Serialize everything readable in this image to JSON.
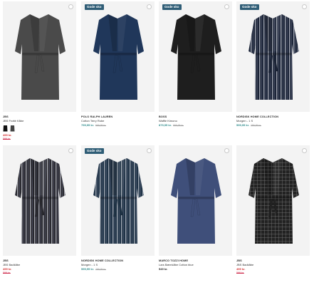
{
  "products": [
    {
      "badge": "",
      "brand": "JBS",
      "name": "JBS Frotté Kåbe",
      "price": "499 kr.",
      "was": "",
      "old_price": "599 kr.",
      "price_tone": "red",
      "robe_color": "#4a4a4a",
      "pattern": "plain",
      "has_swatches": true
    },
    {
      "badge": "Gode sko",
      "brand": "POLO RALPH LAUREN",
      "name": "Cotton Terry Robe",
      "price": "799,95 kr.",
      "was": "999,95 kr.",
      "old_price": "",
      "price_tone": "teal",
      "robe_color": "#20375a",
      "pattern": "plain",
      "has_swatches": false
    },
    {
      "badge": "Gode sko",
      "brand": "BOSS",
      "name": "Waffle Kimono",
      "price": "879,95 kr.",
      "was": "999,95 kr.",
      "old_price": "",
      "price_tone": "teal",
      "robe_color": "#1e1e1e",
      "pattern": "plain",
      "has_swatches": false
    },
    {
      "badge": "Gode sko",
      "brand": "NORDISK HOME COLLECTION",
      "name": "Morgen - 1 S",
      "price": "599,95 kr.",
      "was": "799,95 kr.",
      "old_price": "",
      "price_tone": "teal",
      "robe_color": "#1c2538",
      "pattern": "stripe",
      "has_swatches": false
    },
    {
      "badge": "",
      "brand": "JBS",
      "name": "JBS Badkåbe",
      "price": "499 kr.",
      "was": "",
      "old_price": "599 kr.",
      "price_tone": "red",
      "robe_color": "#2a2a30",
      "pattern": "stripe",
      "has_swatches": false
    },
    {
      "badge": "Gode sko",
      "brand": "NORDISK HOME COLLECTION",
      "name": "Morgen - 1 S",
      "price": "599,95 kr.",
      "was": "799,95 kr.",
      "old_price": "",
      "price_tone": "teal",
      "robe_color": "#1f3346",
      "pattern": "stripe",
      "has_swatches": false
    },
    {
      "badge": "",
      "brand": "MARCO TOZZI HOME",
      "name": "Lars Bæmkåbe Cotton blue",
      "price": "549 kr.",
      "was": "",
      "old_price": "",
      "price_tone": "plain",
      "robe_color": "#3f4f7a",
      "pattern": "plain",
      "has_swatches": false
    },
    {
      "badge": "",
      "brand": "JBS",
      "name": "JBS Badkåbe",
      "price": "499 kr.",
      "was": "",
      "old_price": "599 kr.",
      "price_tone": "red",
      "robe_color": "#222222",
      "pattern": "check",
      "has_swatches": false
    }
  ],
  "badge_colors": {
    "yellow": "#f5d000",
    "blue": "#2f5d76"
  },
  "icons": {
    "favorite": "heart-icon"
  }
}
